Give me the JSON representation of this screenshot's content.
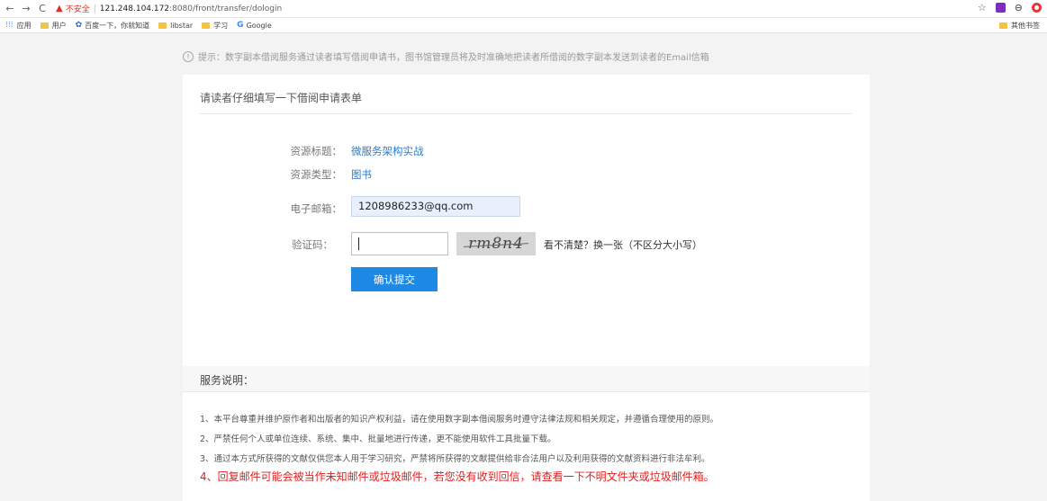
{
  "browser": {
    "url_warning": "不安全",
    "url_host": "121.248.104.172",
    "url_path": ":8080/front/transfer/dologin"
  },
  "bookmarks": {
    "items": [
      {
        "label": "应用",
        "icon": "apps-grid-icon"
      },
      {
        "label": "用户",
        "icon": "folder-icon"
      },
      {
        "label": "百度一下，你就知道",
        "icon": "baidu-icon"
      },
      {
        "label": "libstar",
        "icon": "folder-icon"
      },
      {
        "label": "学习",
        "icon": "folder-icon"
      },
      {
        "label": "Google",
        "icon": "google-icon"
      }
    ],
    "other": "其他书签"
  },
  "hint": {
    "text": "提示：数字副本借阅服务通过读者填写借阅申请书，图书馆管理员将及时准确地把读者所借阅的数字副本发送到读者的Email信箱"
  },
  "form": {
    "title": "请读者仔细填写一下借阅申请表单",
    "resource_title_label": "资源标题：",
    "resource_title_value": "微服务架构实战",
    "resource_type_label": "资源类型：",
    "resource_type_value": "图书",
    "email_label": "电子邮箱：",
    "email_value": "1208986233@qq.com",
    "captcha_label": "验证码：",
    "captcha_value": "",
    "captcha_image_text": "rm8n4",
    "captcha_refresh": "看不清楚？换一张（不区分大小写）",
    "submit_label": "确认提交"
  },
  "service": {
    "title": "服务说明：",
    "notes": [
      "1、本平台尊重并维护原作者和出版者的知识产权利益，请在使用数字副本借阅服务时遵守法律法规和相关规定，并遵循合理使用的原则。",
      "2、严禁任何个人或单位连续、系统、集中、批量地进行传递，更不能使用软件工具批量下载。",
      "3、通过本方式所获得的文献仅供您本人用于学习研究，严禁将所获得的文献提供给非合法用户以及利用获得的文献资料进行非法牟利。",
      "4、回复邮件可能会被当作未知邮件或垃圾邮件，若您没有收到回信，请查看一下不明文件夹或垃圾邮件箱。"
    ]
  }
}
